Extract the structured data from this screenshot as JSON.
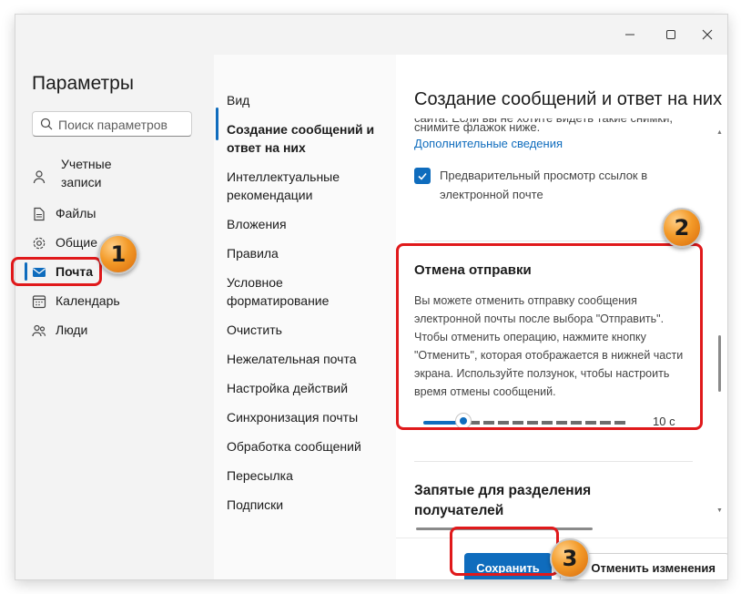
{
  "window": {
    "title": ""
  },
  "sidebar": {
    "title": "Параметры",
    "search_placeholder": "Поиск параметров",
    "items": [
      {
        "label": "Учетные записи",
        "icon": "person-icon"
      },
      {
        "label": "Файлы",
        "icon": "file-icon"
      },
      {
        "label": "Общие",
        "icon": "gear-icon"
      },
      {
        "label": "Почта",
        "icon": "mail-icon",
        "selected": true
      },
      {
        "label": "Календарь",
        "icon": "calendar-icon"
      },
      {
        "label": "Люди",
        "icon": "people-icon"
      }
    ]
  },
  "middle": {
    "items": [
      {
        "label": "Вид"
      },
      {
        "label": "Создание сообщений и ответ на них",
        "selected": true
      },
      {
        "label": "Интеллектуальные рекомендации"
      },
      {
        "label": "Вложения"
      },
      {
        "label": "Правила"
      },
      {
        "label": "Условное форматирование"
      },
      {
        "label": "Очистить"
      },
      {
        "label": "Нежелательная почта"
      },
      {
        "label": "Настройка действий"
      },
      {
        "label": "Синхронизация почты"
      },
      {
        "label": "Обработка сообщений"
      },
      {
        "label": "Пересылка"
      },
      {
        "label": "Подписки"
      }
    ]
  },
  "panel": {
    "title": "Создание сообщений и ответ на них",
    "truncated_text_1": "сайта. Если вы не хотите видеть такие снимки,",
    "truncated_text_2": "снимите флажок ниже.",
    "more_info_link": "Дополнительные сведения",
    "link_preview_checkbox": {
      "label": "Предварительный просмотр ссылок в электронной почте",
      "checked": true
    },
    "undo_send": {
      "title": "Отмена отправки",
      "description": "Вы можете отменить отправку сообщения электронной почты после выбора \"Отправить\". Чтобы отменить операцию, нажмите кнопку \"Отменить\", которая отображается в нижней части экрана. Используйте ползунок, чтобы настроить время отмены сообщений.",
      "slider_value": 10,
      "slider_max": 60,
      "slider_label": "10 с"
    },
    "next_section_title": "Запятые для разделения получателей",
    "save_button": "Сохранить",
    "discard_button": "Отменить изменения"
  },
  "annotations": {
    "badge_1": "1",
    "badge_2": "2",
    "badge_3": "3",
    "highlight_color": "#e0191b"
  },
  "colors": {
    "accent": "#0f6cbd"
  }
}
